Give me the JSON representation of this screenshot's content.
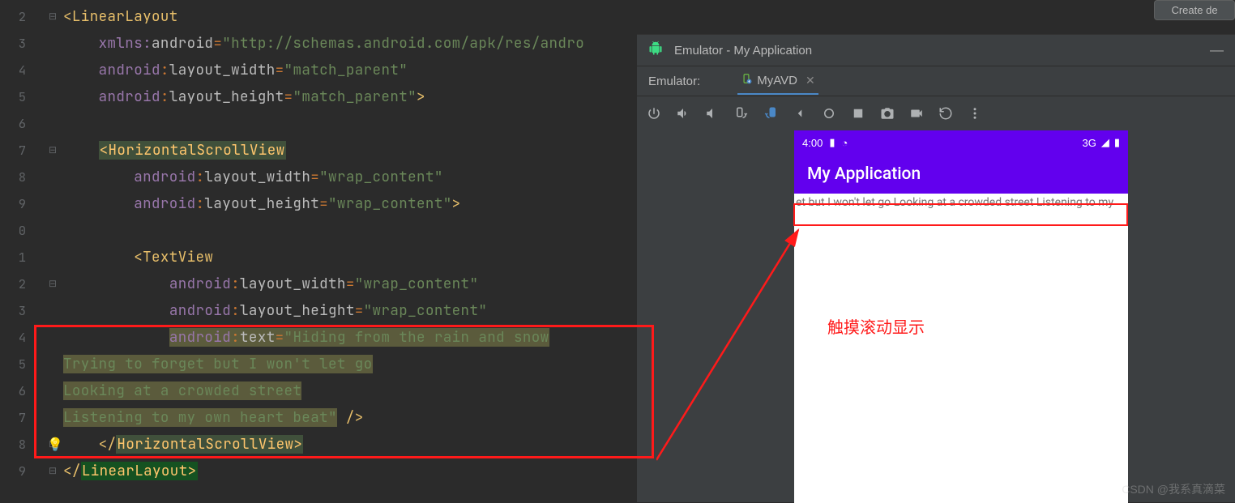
{
  "gutter": [
    "2",
    "3",
    "4",
    "5",
    "6",
    "7",
    "8",
    "9",
    "0",
    "1",
    "2",
    "3",
    "4",
    "5",
    "6",
    "7",
    "8",
    "9"
  ],
  "folds": [
    "⊟",
    "",
    "",
    "",
    "",
    "⊟",
    "",
    "",
    "",
    "",
    "⊟",
    "",
    "",
    "",
    "",
    "",
    "⊟",
    "⊟"
  ],
  "code": {
    "ll_open": "<LinearLayout",
    "xmlns_ns": "xmlns:",
    "xmlns_key": "android",
    "eq": "=",
    "xmlns_val": "\"http://schemas.android.com/apk/res/andro",
    "and_ns": "android",
    "colon": ":",
    "lw": "layout_width",
    "mp": "\"match_parent\"",
    "lh": "layout_height",
    "mp2": "\"match_parent\"",
    "gt": ">",
    "hsv_open": "<HorizontalScrollView",
    "wc": "\"wrap_content\"",
    "tv_open": "<TextView",
    "text_attr": "text",
    "text_val_l1": "\"Hiding from the rain and snow",
    "text_val_l2": "Trying to forget but I won't let go",
    "text_val_l3": "Looking at a crowded street",
    "text_val_l4": "Listening to my own heart beat\"",
    "selfclose": " />",
    "hsv_close": "HorizontalScrollView>",
    "ll_close": "LinearLayout>"
  },
  "create_btn": "Create de",
  "emu": {
    "title": "Emulator - My Application",
    "label": "Emulator:",
    "tab": "MyAVD",
    "clock": "4:00",
    "net": "3G",
    "app_title": "My Application",
    "scroll_text": "et but I won't let go Looking at a crowded street Listening to my"
  },
  "annotation": "触摸滚动显示",
  "watermark": "CSDN @我系真滴菜"
}
